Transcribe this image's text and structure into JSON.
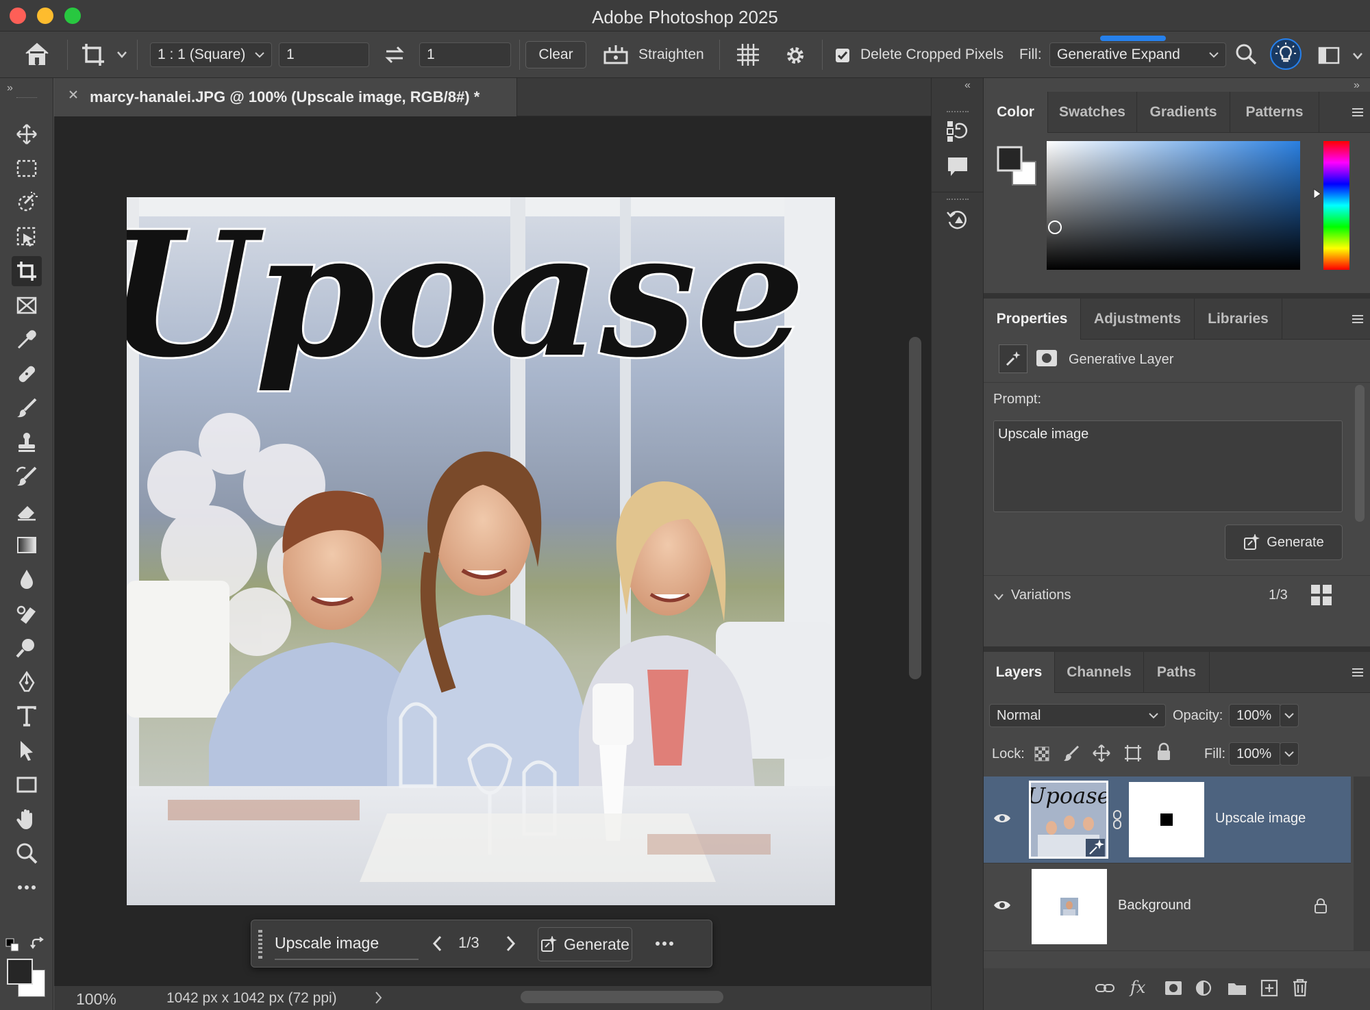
{
  "app": {
    "title": "Adobe Photoshop 2025"
  },
  "options_bar": {
    "ratio_select": "1 : 1 (Square)",
    "width_value": "1",
    "height_value": "1",
    "clear_label": "Clear",
    "straighten_label": "Straighten",
    "delete_cropped_label": "Delete Cropped Pixels",
    "delete_cropped_checked": true,
    "fill_label": "Fill:",
    "fill_select": "Generative Expand"
  },
  "document": {
    "tab_title": "marcy-hanalei.JPG @ 100% (Upscale image, RGB/8#) *",
    "canvas_text": "Upoase"
  },
  "status": {
    "zoom": "100%",
    "info": "1042 px x 1042 px (72 ppi)"
  },
  "contextual_bar": {
    "prompt": "Upscale image",
    "counter": "1/3",
    "generate_label": "Generate"
  },
  "color_panel": {
    "tabs": [
      "Color",
      "Swatches",
      "Gradients",
      "Patterns"
    ],
    "active_tab": "Color"
  },
  "properties_panel": {
    "tabs": [
      "Properties",
      "Adjustments",
      "Libraries"
    ],
    "layer_type": "Generative Layer",
    "prompt_label": "Prompt:",
    "prompt_text": "Upscale image",
    "generate_label": "Generate",
    "variations_label": "Variations",
    "variations_count": "1/3"
  },
  "layers_panel": {
    "tabs": [
      "Layers",
      "Channels",
      "Paths"
    ],
    "blend_mode": "Normal",
    "opacity_label": "Opacity:",
    "opacity_value": "100%",
    "lock_label": "Lock:",
    "fill_label": "Fill:",
    "fill_value": "100%",
    "layers": [
      {
        "name": "Upscale image",
        "selected": true,
        "visible": true
      },
      {
        "name": "Background",
        "selected": false,
        "visible": true,
        "locked": true
      }
    ]
  },
  "colors": {
    "accent": "#2680eb",
    "selected_layer": "#4d637f",
    "panel_bg": "#474747"
  }
}
